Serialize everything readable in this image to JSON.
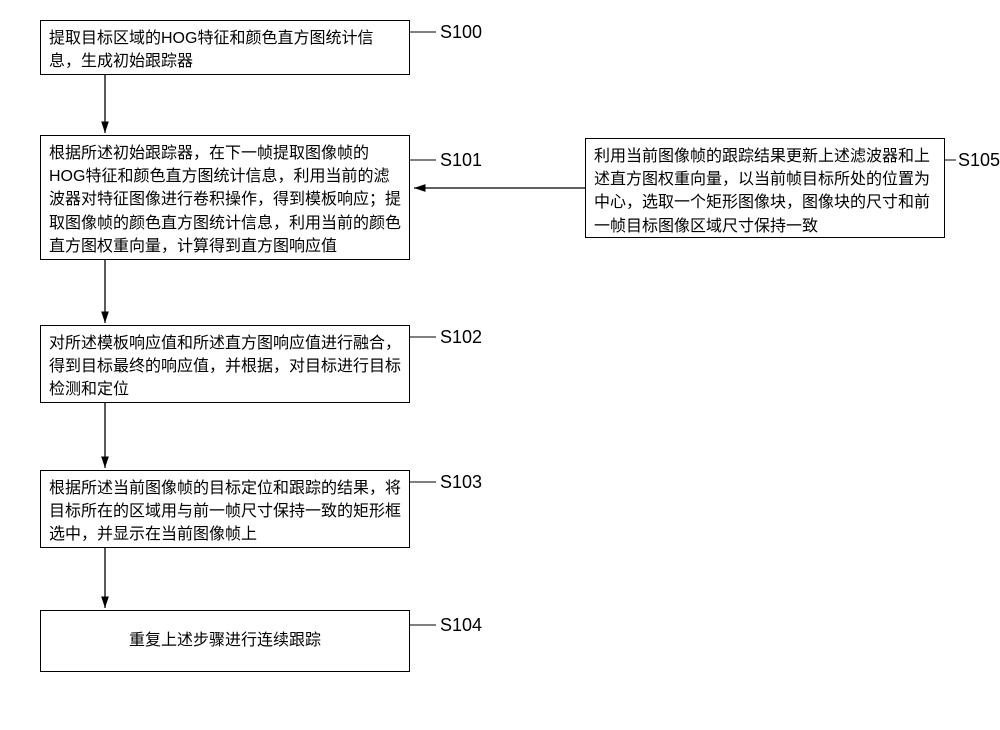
{
  "steps": {
    "s100": {
      "label": "S100",
      "text": "提取目标区域的HOG特征和颜色直方图统计信息，生成初始跟踪器"
    },
    "s101": {
      "label": "S101",
      "text": "根据所述初始跟踪器，在下一帧提取图像帧的HOG特征和颜色直方图统计信息，利用当前的滤波器对特征图像进行卷积操作，得到模板响应；提取图像帧的颜色直方图统计信息，利用当前的颜色直方图权重向量，计算得到直方图响应值"
    },
    "s102": {
      "label": "S102",
      "text": "对所述模板响应值和所述直方图响应值进行融合，得到目标最终的响应值，并根据，对目标进行目标检测和定位"
    },
    "s103": {
      "label": "S103",
      "text": "根据所述当前图像帧的目标定位和跟踪的结果，将目标所在的区域用与前一帧尺寸保持一致的矩形框选中，并显示在当前图像帧上"
    },
    "s104": {
      "label": "S104",
      "text": "重复上述步骤进行连续跟踪"
    },
    "s105": {
      "label": "S105",
      "text": "利用当前图像帧的跟踪结果更新上述滤波器和上述直方图权重向量，以当前帧目标所处的位置为中心，选取一个矩形图像块，图像块的尺寸和前一帧目标图像区域尺寸保持一致"
    }
  }
}
